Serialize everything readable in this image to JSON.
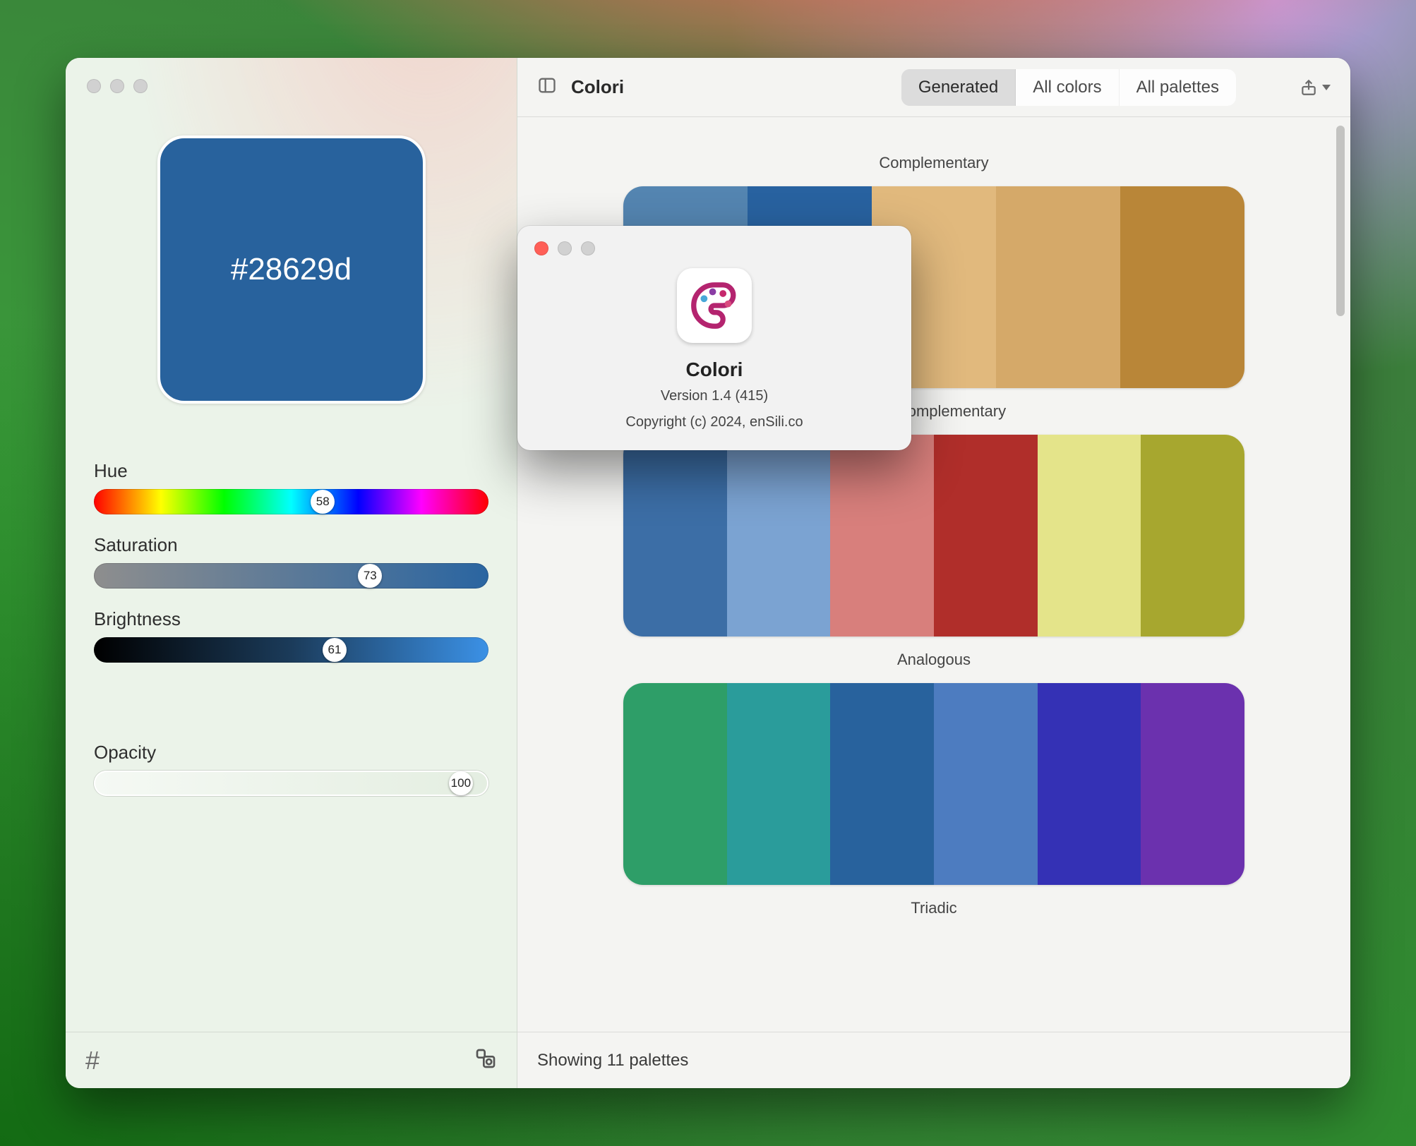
{
  "app_title": "Colori",
  "current_color": {
    "hex": "#28629d",
    "hex_display": "#28629d"
  },
  "sliders": {
    "hue": {
      "label": "Hue",
      "value": 58,
      "percent": 58
    },
    "saturation": {
      "label": "Saturation",
      "value": 73,
      "percent": 70
    },
    "brightness": {
      "label": "Brightness",
      "value": 61,
      "percent": 61
    },
    "opacity": {
      "label": "Opacity",
      "value": 100,
      "percent": 93
    }
  },
  "tabs": {
    "generated": "Generated",
    "all_colors": "All colors",
    "all_palettes": "All palettes",
    "active": "generated"
  },
  "palettes": [
    {
      "name": "Complementary",
      "colors": [
        "#5485b1",
        "#2862a0",
        "#e1b97d",
        "#d5a969",
        "#b98638"
      ]
    },
    {
      "name": "Split Complementary",
      "colors": [
        "#3c6ea6",
        "#7ba3d2",
        "#d87f7c",
        "#b02e2a",
        "#e4e48a",
        "#a7a72f"
      ]
    },
    {
      "name": "Analogous",
      "colors": [
        "#2e9e68",
        "#2a9c9b",
        "#28629d",
        "#4d7cc0",
        "#3431b5",
        "#6b31ae"
      ]
    },
    {
      "name": "Triadic",
      "colors": []
    }
  ],
  "footer": {
    "showing_text": "Showing 11 palettes"
  },
  "about": {
    "app_name": "Colori",
    "version": "Version 1.4 (415)",
    "copyright": "Copyright (c) 2024, enSili.co"
  }
}
